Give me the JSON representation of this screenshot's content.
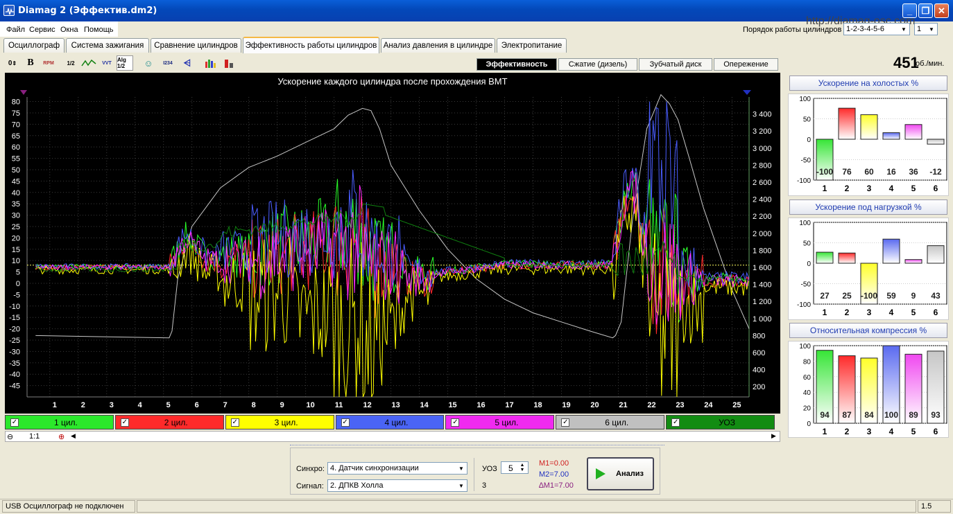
{
  "window": {
    "title": "Diamag 2 (Эффектив.dm2)",
    "url": "http://diamag-osc.com"
  },
  "menu": [
    "Файл",
    "Сервис",
    "Окна",
    "Помощь"
  ],
  "firing_order": {
    "label": "Порядок работы цилиндров",
    "value": "1-2-3-4-5-6",
    "cyl_value": "1"
  },
  "tabs": [
    "Осциллограф",
    "Система зажигания",
    "Сравнение цилиндров",
    "Эффективность работы цилиндров",
    "Анализ давления в цилиндре",
    "Электропитание"
  ],
  "active_tab": 3,
  "subtabs": [
    "Эффективность",
    "Сжатие (дизель)",
    "Зубчатый диск",
    "Опережение"
  ],
  "active_subtab": 0,
  "toolbar": {
    "b1": "0",
    "b2": "B",
    "b3": "RPM",
    "b4": "1/2",
    "b5": "VVT",
    "b6": "Alg 1/2",
    "b7": "I234"
  },
  "rpm": {
    "value": "451",
    "unit": "об./мин."
  },
  "chart_data": {
    "type": "line",
    "title": "Ускорение каждого цилиндра после прохождения ВМТ",
    "x": {
      "min": 0.2,
      "max": 25.6,
      "ticks": [
        1,
        2,
        3,
        4,
        5,
        6,
        7,
        8,
        9,
        10,
        11,
        12,
        13,
        14,
        15,
        16,
        17,
        18,
        19,
        20,
        21,
        22,
        23,
        24,
        25
      ]
    },
    "y_left": {
      "min": -50,
      "max": 82,
      "ticks": [
        80,
        75,
        70,
        65,
        60,
        55,
        50,
        45,
        40,
        35,
        30,
        25,
        20,
        15,
        10,
        5,
        0,
        -5,
        -10,
        -15,
        -20,
        -25,
        -30,
        -35,
        -40,
        -45
      ]
    },
    "y_right": {
      "min": 80,
      "max": 3600,
      "ticks": [
        "3 400",
        "3 200",
        "3 000",
        "2 800",
        "2 600",
        "2 400",
        "2 200",
        "2 000",
        "1 800",
        "1 600",
        "1 400",
        "1 200",
        "1 000",
        "800",
        "600",
        "400",
        "200"
      ],
      "tick_values": [
        3400,
        3200,
        3000,
        2800,
        2600,
        2400,
        2200,
        2000,
        1800,
        1600,
        1400,
        1200,
        1000,
        800,
        600,
        400,
        200
      ]
    },
    "reference_line": 8,
    "rpm_series": {
      "name": "rpm",
      "color": "#c8c8c8",
      "x": [
        0.5,
        5.2,
        5.3,
        5.5,
        6,
        7,
        8,
        9,
        10,
        11,
        11.5,
        12,
        12.3,
        12.6,
        13,
        14,
        15,
        16,
        17,
        18,
        19,
        20,
        20.8,
        20.9,
        21.1,
        21.5,
        22,
        22.5,
        22.8,
        23.1,
        23.5,
        24,
        24.5,
        25,
        25.6
      ],
      "y": [
        -23,
        -24,
        -21,
        2,
        25,
        42,
        51,
        56,
        62,
        68,
        74,
        77,
        76,
        68,
        52,
        32,
        15,
        2,
        -7,
        -13,
        -17,
        -21,
        -24,
        -23,
        -17,
        28,
        68,
        83,
        79,
        72,
        55,
        33,
        15,
        -3,
        -20
      ]
    },
    "series": [
      {
        "name": "1 цил.",
        "color": "#2aff2a"
      },
      {
        "name": "2 цил.",
        "color": "#ff2a2a"
      },
      {
        "name": "3 цил.",
        "color": "#ffff00"
      },
      {
        "name": "4 цил.",
        "color": "#4a5dff"
      },
      {
        "name": "5 цил.",
        "color": "#ff2aff"
      },
      {
        "name": "6 цил.",
        "color": "#c0c0c0"
      },
      {
        "name": "УОЗ",
        "color": "#108010"
      }
    ]
  },
  "legend_bg": [
    "#2be82b",
    "#ff2a2a",
    "#ffff00",
    "#4a64f5",
    "#f02af0",
    "#c0c0c0",
    "#128c12"
  ],
  "zoom": "1:1",
  "bar_charts": [
    {
      "title": "Ускорение на холостых %",
      "yticks": [
        "100",
        "50",
        "0",
        "-50",
        "-100"
      ],
      "ymin": -100,
      "ymax": 100,
      "categories": [
        "1",
        "2",
        "3",
        "4",
        "5",
        "6"
      ],
      "values": [
        -100,
        76,
        60,
        16,
        36,
        -12
      ],
      "labels": [
        "-100",
        "76",
        "60",
        "16",
        "36",
        "-12"
      ]
    },
    {
      "title": "Ускорение под нагрузкой %",
      "yticks": [
        "100",
        "50",
        "0",
        "-50",
        "-100"
      ],
      "ymin": -100,
      "ymax": 100,
      "categories": [
        "1",
        "2",
        "3",
        "4",
        "5",
        "6"
      ],
      "values": [
        27,
        25,
        -100,
        59,
        9,
        43
      ],
      "labels": [
        "27",
        "25",
        "-100",
        "59",
        "9",
        "43"
      ]
    },
    {
      "title": "Относительная компрессия %",
      "yticks": [
        "100",
        "80",
        "60",
        "40",
        "20",
        "0"
      ],
      "ymin": 0,
      "ymax": 100,
      "categories": [
        "1",
        "2",
        "3",
        "4",
        "5",
        "6"
      ],
      "values": [
        94,
        87,
        84,
        100,
        89,
        93
      ],
      "labels": [
        "94",
        "87",
        "84",
        "100",
        "89",
        "93"
      ]
    }
  ],
  "bar_colors": [
    "#36e536",
    "#ff2a2a",
    "#ffff2a",
    "#5a6af0",
    "#f048f0",
    "#c6c6c6"
  ],
  "controls": {
    "sync_label": "Синхро:",
    "sync_value": "4.  Датчик синхронизации",
    "signal_label": "Сигнал:",
    "signal_value": "2.  ДПКВ Холла",
    "uoz_label": "УОЗ",
    "uoz_value": "5",
    "uoz_sub": "3",
    "m1": "M1=0.00",
    "m2": "M2=7.00",
    "dm1": "∆M1=7.00",
    "analyze": "Анализ"
  },
  "status": {
    "left": "USB Осциллограф не подключен",
    "right": "1.5"
  }
}
